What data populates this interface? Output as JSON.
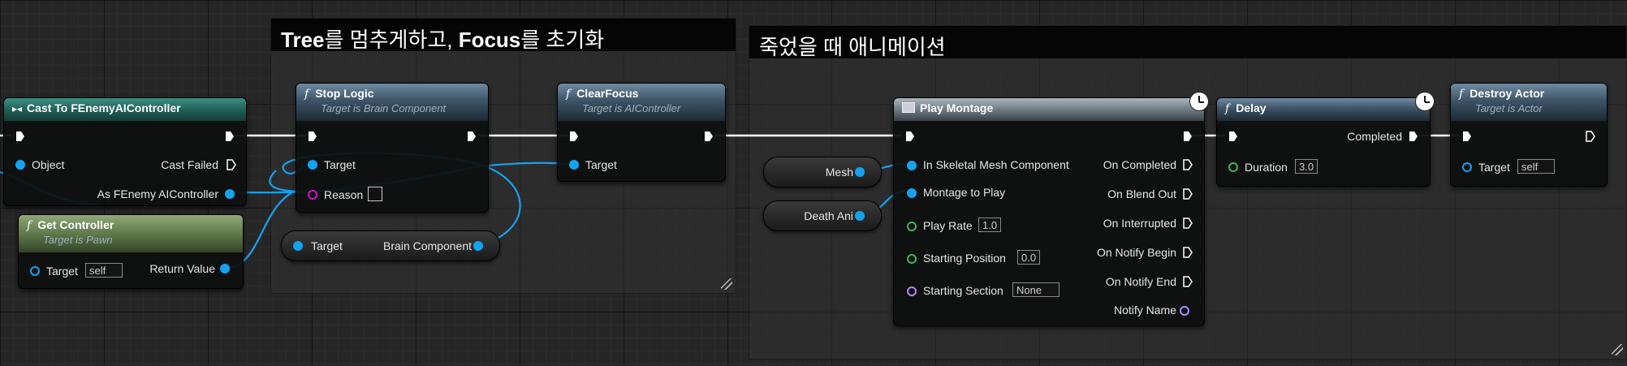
{
  "comments": {
    "left": {
      "bold1": "Tree",
      "text1": "를 멈추게하고, ",
      "bold2": "Focus",
      "text2": "를 초기화"
    },
    "right": {
      "text": "죽었을 때 애니메이션"
    }
  },
  "nodes": {
    "cast": {
      "title": "Cast To FEnemyAIController",
      "pin_object": "Object",
      "pin_cast_failed": "Cast Failed",
      "pin_as": "As FEnemy AIController"
    },
    "get_controller": {
      "title": "Get Controller",
      "subtitle": "Target is Pawn",
      "pin_target": "Target",
      "target_value": "self",
      "pin_return": "Return Value"
    },
    "stop_logic": {
      "title": "Stop Logic",
      "subtitle": "Target is Brain Component",
      "pin_target": "Target",
      "pin_reason": "Reason"
    },
    "brain_component": {
      "pin_target": "Target",
      "pin_out": "Brain Component"
    },
    "clear_focus": {
      "title": "ClearFocus",
      "subtitle": "Target is AIController",
      "pin_target": "Target"
    },
    "mesh_var": {
      "label": "Mesh"
    },
    "death_ani_var": {
      "label": "Death Ani"
    },
    "play_montage": {
      "title": "Play Montage",
      "pin_mesh": "In Skeletal Mesh Component",
      "pin_montage": "Montage to Play",
      "pin_rate": "Play Rate",
      "rate_value": "1.0",
      "pin_pos": "Starting Position",
      "pos_value": "0.0",
      "pin_section": "Starting Section",
      "section_value": "None",
      "out_completed": "On Completed",
      "out_blend": "On Blend Out",
      "out_interrupted": "On Interrupted",
      "out_notify_begin": "On Notify Begin",
      "out_notify_end": "On Notify End",
      "out_notify_name": "Notify Name"
    },
    "delay": {
      "title": "Delay",
      "out_completed": "Completed",
      "pin_duration": "Duration",
      "duration_value": "3.0"
    },
    "destroy_actor": {
      "title": "Destroy Actor",
      "subtitle": "Target is Actor",
      "pin_target": "Target",
      "target_value": "self"
    }
  },
  "colors": {
    "exec_wire": "#ffffff",
    "object_pin": "#13a3f3",
    "float_pin": "#3cb84c",
    "name_pin": "#b089ff",
    "text_pin": "#d014c8"
  }
}
